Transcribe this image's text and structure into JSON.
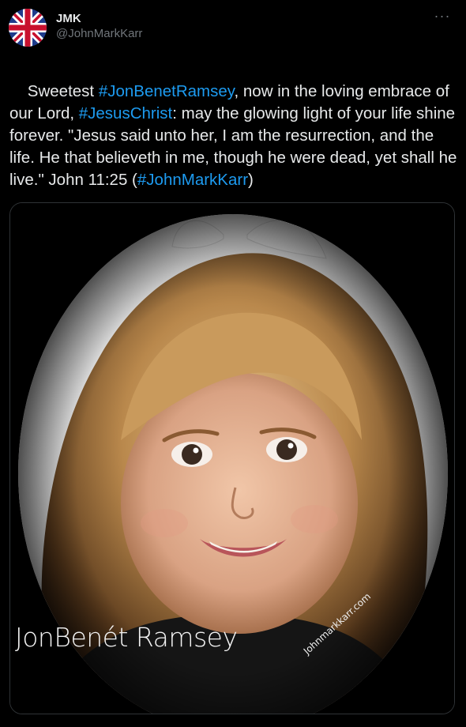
{
  "author": {
    "display_name": "JMK",
    "handle": "@JohnMarkKarr",
    "avatar_icon": "union-jack-flag-icon"
  },
  "more_label": "···",
  "tweet": {
    "segments": [
      {
        "text": "Sweetest ",
        "type": "text"
      },
      {
        "text": "#JonBenetRamsey",
        "type": "hashtag"
      },
      {
        "text": ", now in the loving embrace of our Lord, ",
        "type": "text"
      },
      {
        "text": "#JesusChrist",
        "type": "hashtag"
      },
      {
        "text": ": may the glowing light of your life shine forever. \"Jesus said unto her, I am the resurrection, and the life. He that believeth in me, though he were dead, yet shall he live.\" John 11:25 (",
        "type": "text"
      },
      {
        "text": "#JohnMarkKarr",
        "type": "hashtag"
      },
      {
        "text": ")",
        "type": "text"
      }
    ]
  },
  "media": {
    "caption": "JonBenét Ramsey",
    "watermark": "Johnmarkkarr.com"
  },
  "colors": {
    "background": "#000000",
    "text": "#e7e9ea",
    "secondary": "#71767b",
    "link": "#1d9bf0"
  }
}
